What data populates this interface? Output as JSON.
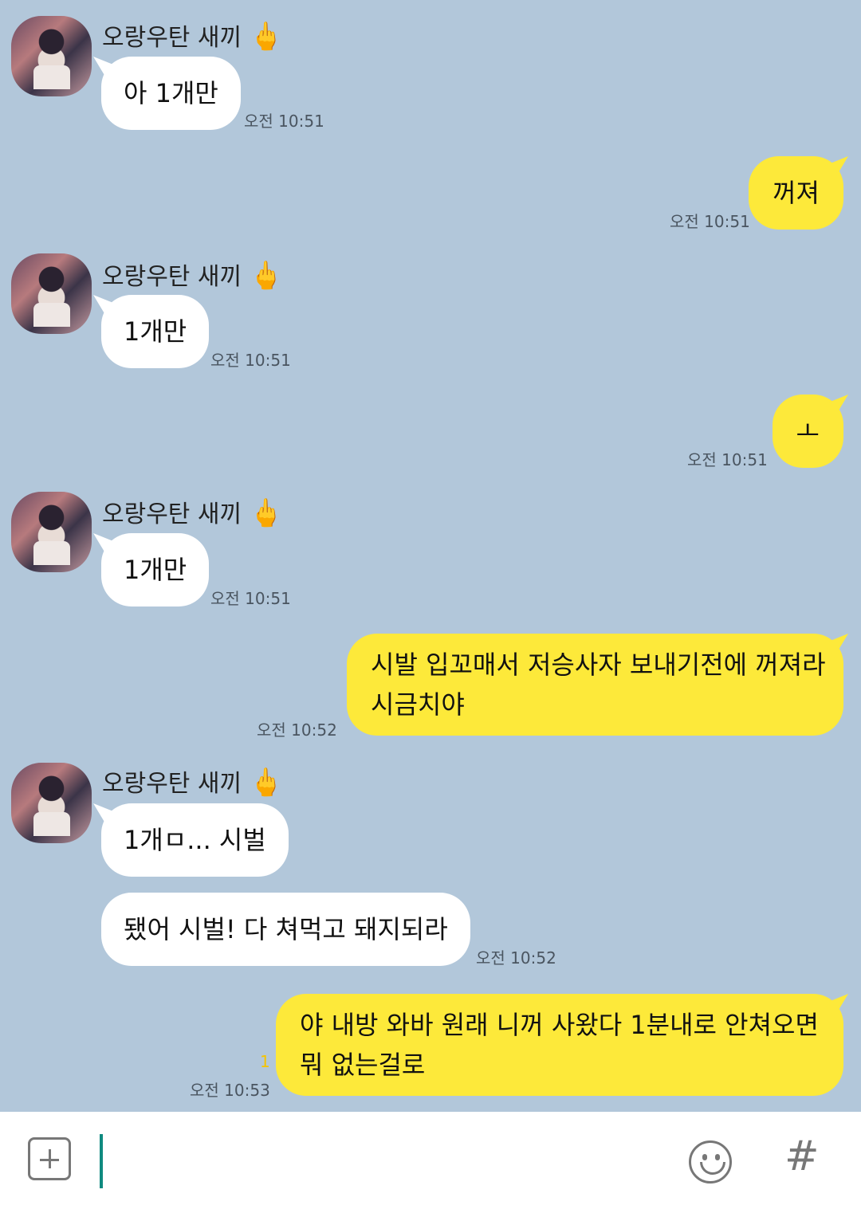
{
  "contact": {
    "name": "오랑우탄 새끼",
    "name_emoji": "🖕"
  },
  "messages": [
    {
      "from": "them",
      "text": "아 1개만",
      "time": "오전 10:51"
    },
    {
      "from": "me",
      "text": "꺼져",
      "time": "오전 10:51"
    },
    {
      "from": "them",
      "text": "1개만",
      "time": "오전 10:51"
    },
    {
      "from": "me",
      "text": "ㅗ",
      "time": "오전 10:51"
    },
    {
      "from": "them",
      "text": "1개만",
      "time": "오전 10:51"
    },
    {
      "from": "me",
      "lines": [
        "시발 입꼬매서 저승사자 보내기전에 꺼져라",
        "시금치야"
      ],
      "time": "오전 10:52"
    },
    {
      "from": "them",
      "text": "1개ㅁ... 시벌"
    },
    {
      "from": "them",
      "text": "됐어 시벌! 다 쳐먹고 돼지되라",
      "time": "오전 10:52"
    },
    {
      "from": "me",
      "lines": [
        "야 내방 와바 원래 니꺼 사왔다 1분내로 안쳐오면",
        "뭐 없는걸로"
      ],
      "time": "오전 10:53",
      "unread": "1"
    }
  ],
  "input": {
    "value": ""
  },
  "icons": {
    "attach": "plus-box-icon",
    "emoji": "smiley-icon",
    "hashtag": "hashtag-icon"
  },
  "colors": {
    "background": "#b2c7da",
    "my_bubble": "#fde93a",
    "their_bubble": "#ffffff",
    "cursor": "#0f8a80"
  }
}
